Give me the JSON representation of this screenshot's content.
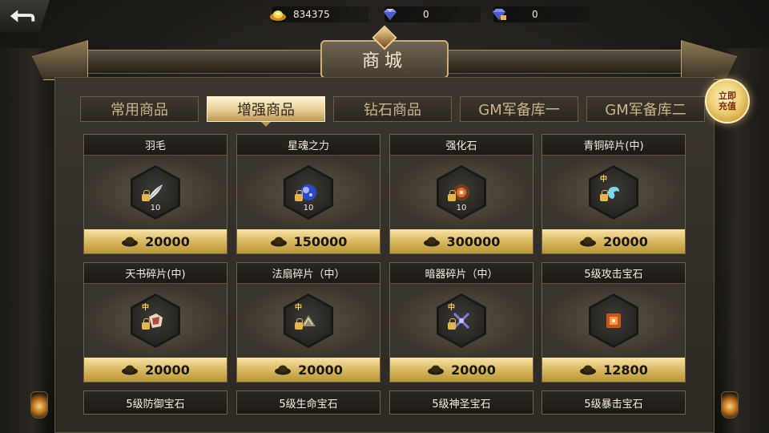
{
  "topbar": {
    "back_icon": "back-arrow-icon",
    "currencies": [
      {
        "icon": "gold-ingot-icon",
        "value": "834375"
      },
      {
        "icon": "diamond-icon",
        "value": "0"
      },
      {
        "icon": "bound-diamond-icon",
        "value": "0"
      }
    ]
  },
  "title": "商城",
  "topup_label": "立即充值",
  "tabs": [
    "常用商品",
    "增强商品",
    "钻石商品",
    "GM军备库一",
    "GM军备库二"
  ],
  "active_tab": 1,
  "items": [
    {
      "name": "羽毛",
      "icon": "feather-icon",
      "qty": "10",
      "price": "20000"
    },
    {
      "name": "星魂之力",
      "icon": "star-orb-icon",
      "qty": "10",
      "price": "150000"
    },
    {
      "name": "强化石",
      "icon": "enhance-stone-icon",
      "qty": "10",
      "price": "300000"
    },
    {
      "name": "青铜碎片(中)",
      "icon": "bronze-fragment-icon",
      "badge": "中",
      "price": "20000"
    },
    {
      "name": "天书碎片(中)",
      "icon": "book-fragment-icon",
      "badge": "中",
      "price": "20000"
    },
    {
      "name": "法扇碎片（中）",
      "icon": "fan-fragment-icon",
      "badge": "中",
      "price": "20000"
    },
    {
      "name": "暗器碎片（中）",
      "icon": "hidden-weapon-fragment-icon",
      "badge": "中",
      "price": "20000"
    },
    {
      "name": "5级攻击宝石",
      "icon": "attack-gem-icon",
      "price": "12800"
    },
    {
      "name": "5级防御宝石"
    },
    {
      "name": "5级生命宝石"
    },
    {
      "name": "5级神圣宝石"
    },
    {
      "name": "5级暴击宝石"
    }
  ],
  "colors": {
    "accent_gold": "#d9b963",
    "tab_active": "#e2c98f",
    "panel_bg": "#3a352d"
  }
}
